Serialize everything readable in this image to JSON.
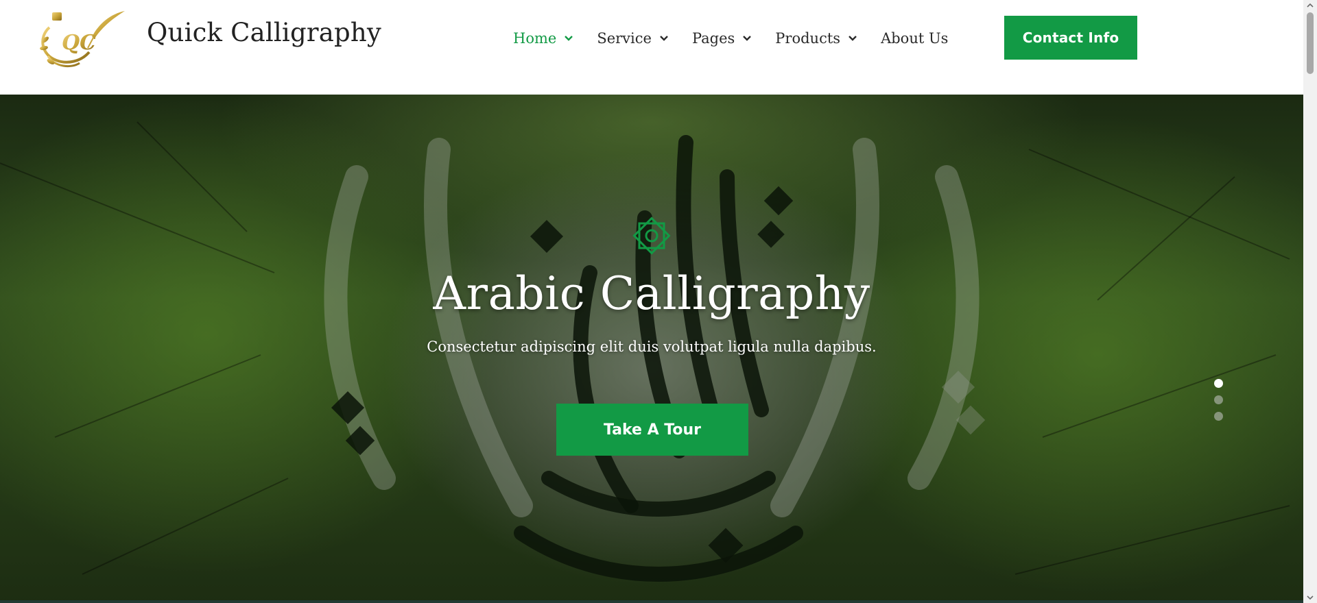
{
  "header": {
    "brand": "Quick Calligraphy",
    "logo_text": "QC",
    "nav": [
      {
        "label": "Home",
        "active": true,
        "has_dropdown": true
      },
      {
        "label": "Service",
        "active": false,
        "has_dropdown": true
      },
      {
        "label": "Pages",
        "active": false,
        "has_dropdown": true
      },
      {
        "label": "Products",
        "active": false,
        "has_dropdown": true
      },
      {
        "label": "About Us",
        "active": false,
        "has_dropdown": false
      }
    ],
    "contact_label": "Contact Info"
  },
  "hero": {
    "title": "Arabic Calligraphy",
    "subtitle": "Consectetur adipiscing elit duis volutpat ligula nulla dapibus.",
    "cta_label": "Take A Tour",
    "slides": {
      "count": 3,
      "active_index": 0
    }
  },
  "colors": {
    "accent": "#129a45",
    "text_dark": "#222222",
    "logo_gold": "#c9a53a"
  },
  "icons": {
    "ornament": "star-ornament-icon",
    "dropdown": "chevron-down-icon"
  }
}
